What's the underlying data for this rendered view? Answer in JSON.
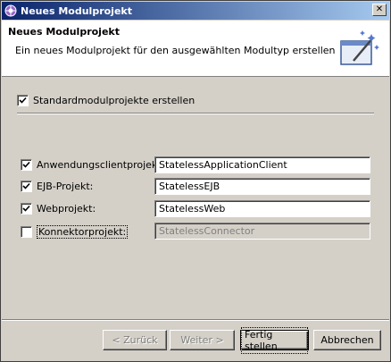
{
  "window": {
    "title": "Neues Modulprojekt"
  },
  "banner": {
    "title": "Neues Modulprojekt",
    "description": "Ein neues Modulprojekt für den ausgewählten Modultyp erstellen"
  },
  "default_option": {
    "label": "Standardmodulprojekte erstellen",
    "checked": true
  },
  "projects": [
    {
      "label": "Anwendungsclientprojekt:",
      "checked": true,
      "value": "StatelessApplicationClient",
      "enabled": true
    },
    {
      "label": "EJB-Projekt:",
      "checked": true,
      "value": "StatelessEJB",
      "enabled": true
    },
    {
      "label": "Webprojekt:",
      "checked": true,
      "value": "StatelessWeb",
      "enabled": true
    },
    {
      "label": "Konnektorprojekt:",
      "checked": false,
      "value": "StatelessConnector",
      "enabled": false
    }
  ],
  "buttons": {
    "back": "< Zurück",
    "next": "Weiter >",
    "finish": "Fertig stellen",
    "cancel": "Abbrechen"
  },
  "colors": {
    "titlebar_start": "#0a246a",
    "titlebar_end": "#a6caf0",
    "face": "#d4d0c8"
  }
}
